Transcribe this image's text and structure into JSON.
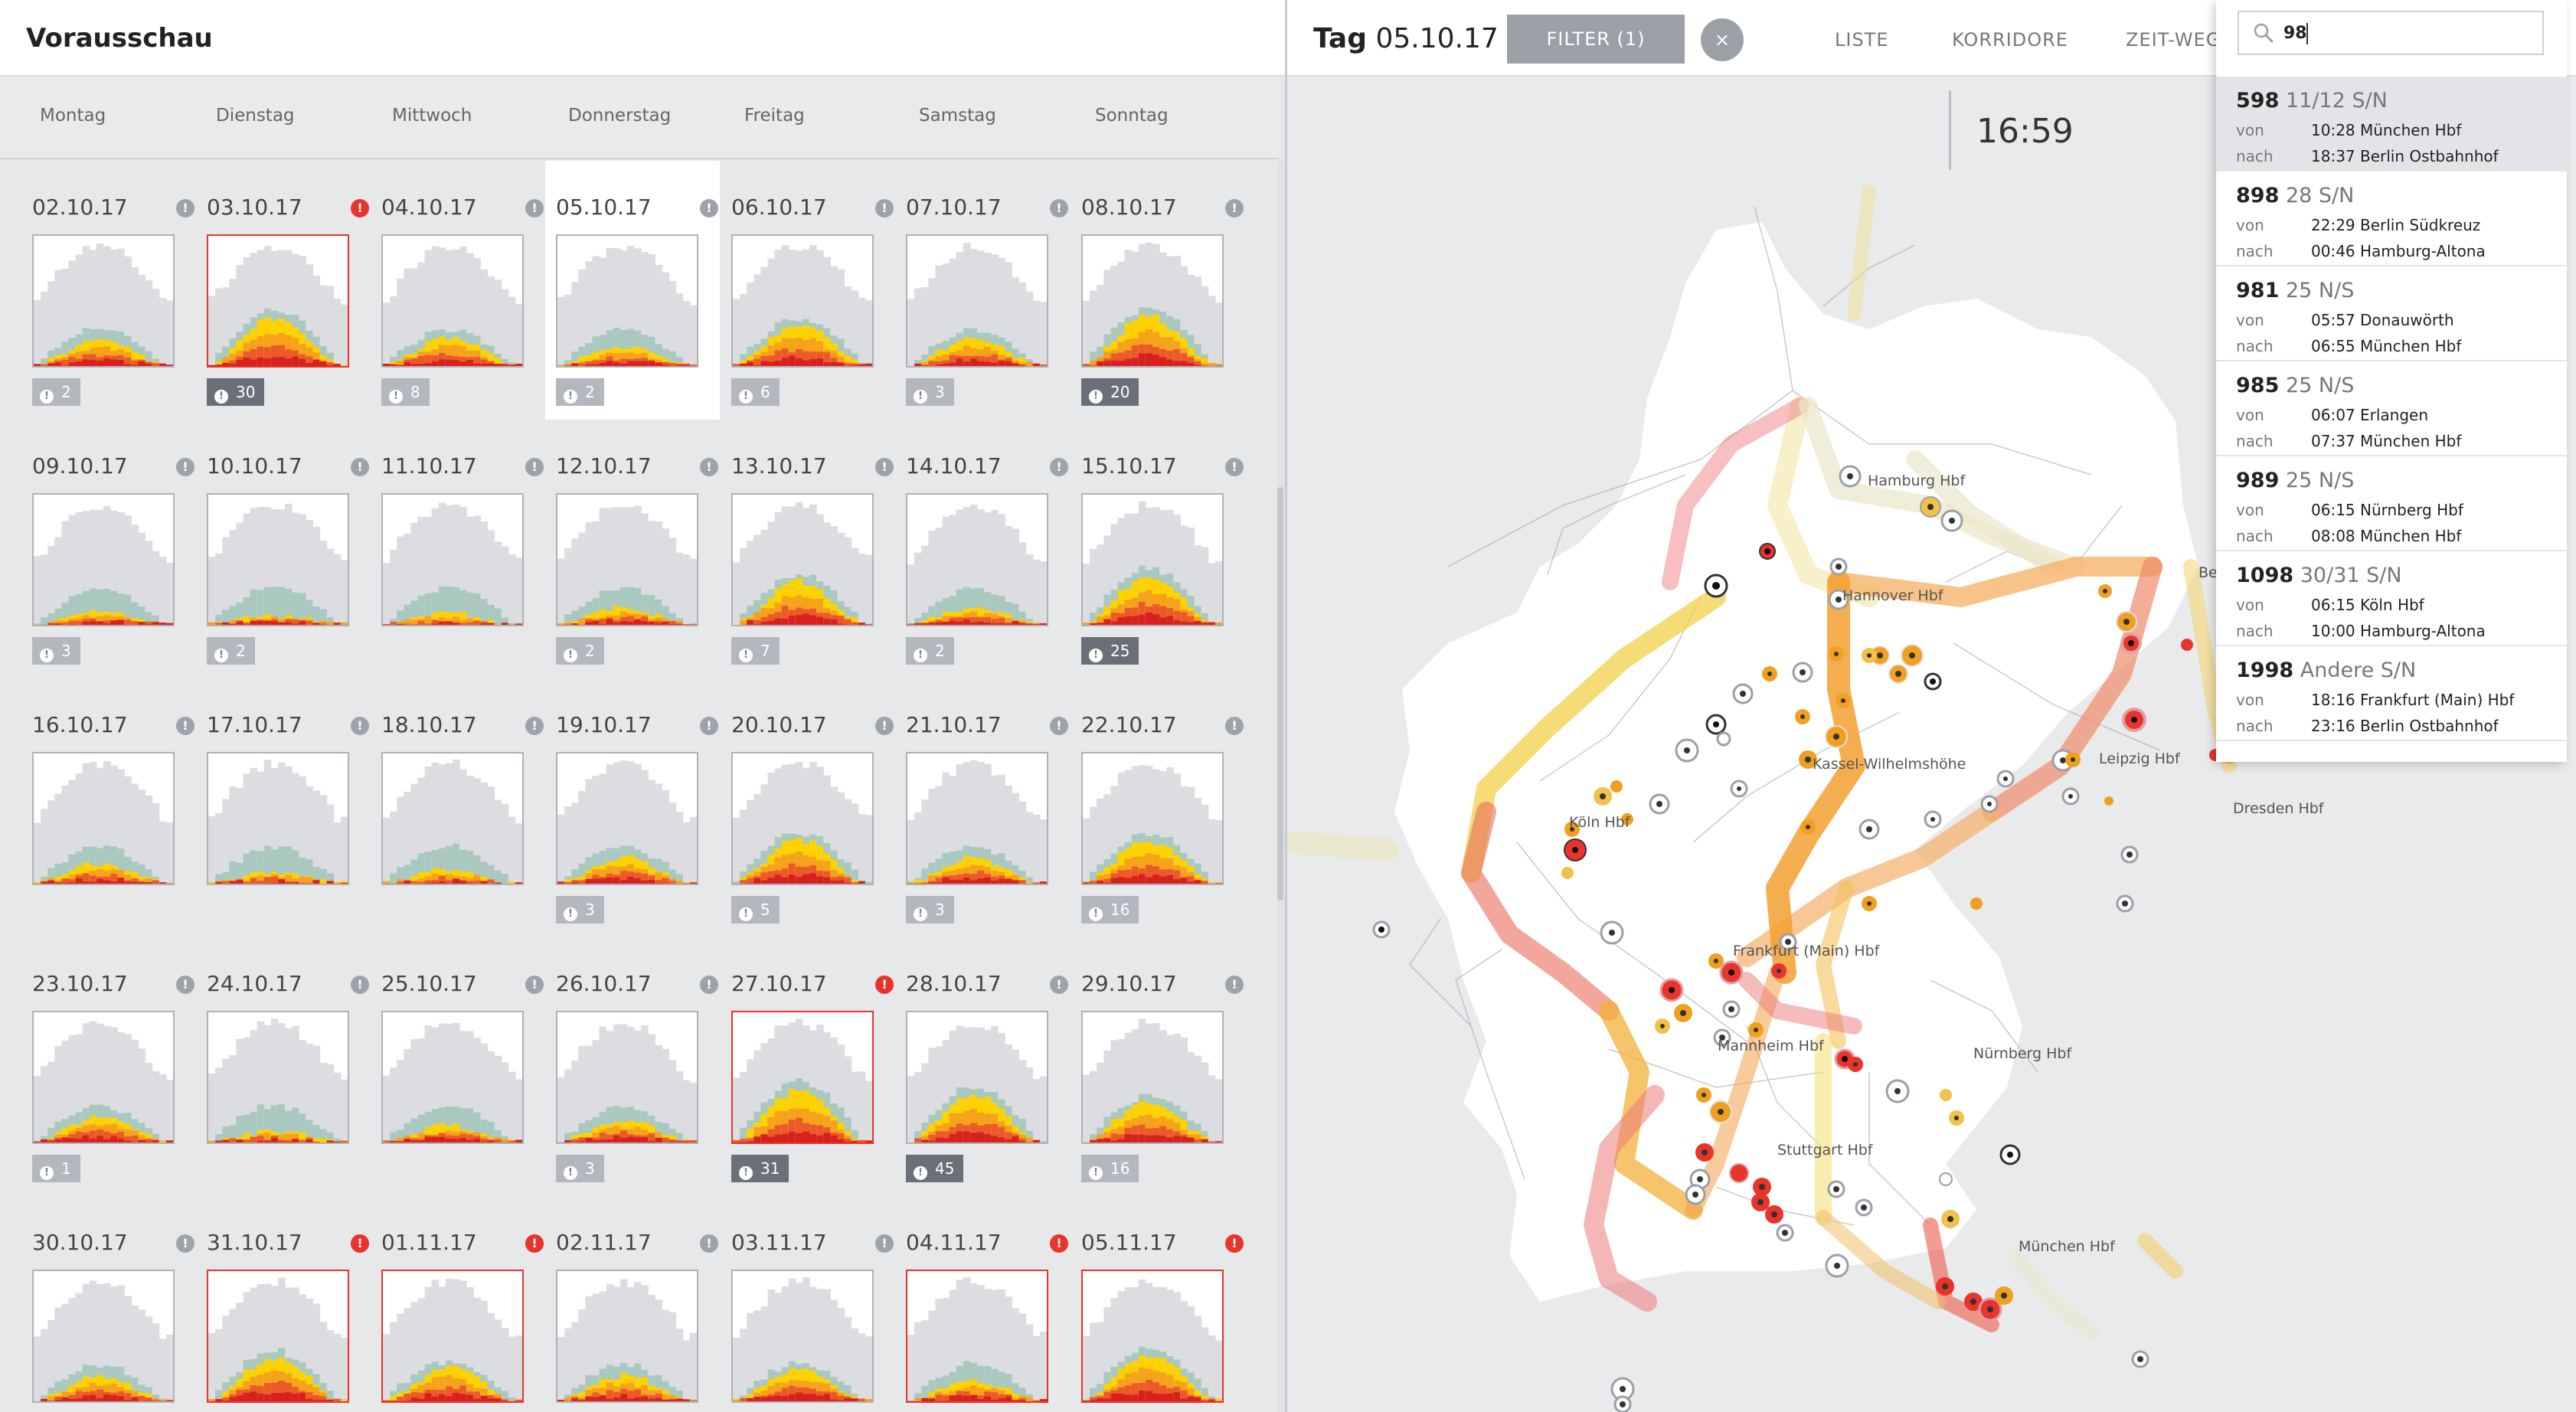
{
  "left": {
    "title": "Vorausschau",
    "weekdays": [
      "Montag",
      "Dienstag",
      "Mittwoch",
      "Donnerstag",
      "Freitag",
      "Samstag",
      "Sonntag"
    ],
    "days": [
      {
        "date": "02.10.17",
        "count": "2",
        "alert": false,
        "dark": false,
        "selected": false,
        "intensity": 0.45
      },
      {
        "date": "03.10.17",
        "count": "30",
        "alert": true,
        "dark": true,
        "selected": false,
        "intensity": 0.85
      },
      {
        "date": "04.10.17",
        "count": "8",
        "alert": false,
        "dark": false,
        "selected": false,
        "intensity": 0.5
      },
      {
        "date": "05.10.17",
        "count": "2",
        "alert": false,
        "dark": false,
        "selected": true,
        "intensity": 0.35
      },
      {
        "date": "06.10.17",
        "count": "6",
        "alert": false,
        "dark": false,
        "selected": false,
        "intensity": 0.7
      },
      {
        "date": "07.10.17",
        "count": "3",
        "alert": false,
        "dark": false,
        "selected": false,
        "intensity": 0.5
      },
      {
        "date": "08.10.17",
        "count": "20",
        "alert": false,
        "dark": true,
        "selected": false,
        "intensity": 0.85
      },
      {
        "date": "09.10.17",
        "count": "3",
        "alert": false,
        "dark": false,
        "selected": false,
        "intensity": 0.25
      },
      {
        "date": "10.10.17",
        "count": "2",
        "alert": false,
        "dark": false,
        "selected": false,
        "intensity": 0.15
      },
      {
        "date": "11.10.17",
        "count": "",
        "alert": false,
        "dark": false,
        "selected": false,
        "intensity": 0.2
      },
      {
        "date": "12.10.17",
        "count": "2",
        "alert": false,
        "dark": false,
        "selected": false,
        "intensity": 0.3
      },
      {
        "date": "13.10.17",
        "count": "7",
        "alert": false,
        "dark": false,
        "selected": false,
        "intensity": 0.75
      },
      {
        "date": "14.10.17",
        "count": "2",
        "alert": false,
        "dark": false,
        "selected": false,
        "intensity": 0.3
      },
      {
        "date": "15.10.17",
        "count": "25",
        "alert": false,
        "dark": true,
        "selected": false,
        "intensity": 0.85
      },
      {
        "date": "16.10.17",
        "count": "",
        "alert": false,
        "dark": false,
        "selected": false,
        "intensity": 0.35
      },
      {
        "date": "17.10.17",
        "count": "",
        "alert": false,
        "dark": false,
        "selected": false,
        "intensity": 0.2
      },
      {
        "date": "18.10.17",
        "count": "",
        "alert": false,
        "dark": false,
        "selected": false,
        "intensity": 0.25
      },
      {
        "date": "19.10.17",
        "count": "3",
        "alert": false,
        "dark": false,
        "selected": false,
        "intensity": 0.45
      },
      {
        "date": "20.10.17",
        "count": "5",
        "alert": false,
        "dark": false,
        "selected": false,
        "intensity": 0.75
      },
      {
        "date": "21.10.17",
        "count": "3",
        "alert": false,
        "dark": false,
        "selected": false,
        "intensity": 0.45
      },
      {
        "date": "22.10.17",
        "count": "16",
        "alert": false,
        "dark": false,
        "selected": false,
        "intensity": 0.75
      },
      {
        "date": "23.10.17",
        "count": "1",
        "alert": false,
        "dark": false,
        "selected": false,
        "intensity": 0.45
      },
      {
        "date": "24.10.17",
        "count": "",
        "alert": false,
        "dark": false,
        "selected": false,
        "intensity": 0.2
      },
      {
        "date": "25.10.17",
        "count": "",
        "alert": false,
        "dark": false,
        "selected": false,
        "intensity": 0.3
      },
      {
        "date": "26.10.17",
        "count": "3",
        "alert": false,
        "dark": false,
        "selected": false,
        "intensity": 0.4
      },
      {
        "date": "27.10.17",
        "count": "31",
        "alert": true,
        "dark": true,
        "selected": false,
        "intensity": 0.9
      },
      {
        "date": "28.10.17",
        "count": "45",
        "alert": false,
        "dark": true,
        "selected": false,
        "intensity": 0.85
      },
      {
        "date": "29.10.17",
        "count": "16",
        "alert": false,
        "dark": false,
        "selected": false,
        "intensity": 0.7
      },
      {
        "date": "30.10.17",
        "count": "",
        "alert": false,
        "dark": false,
        "selected": false,
        "intensity": 0.45
      },
      {
        "date": "31.10.17",
        "count": "",
        "alert": true,
        "dark": false,
        "selected": false,
        "intensity": 0.75
      },
      {
        "date": "01.11.17",
        "count": "",
        "alert": true,
        "dark": false,
        "selected": false,
        "intensity": 0.6
      },
      {
        "date": "02.11.17",
        "count": "",
        "alert": false,
        "dark": false,
        "selected": false,
        "intensity": 0.45
      },
      {
        "date": "03.11.17",
        "count": "",
        "alert": false,
        "dark": false,
        "selected": false,
        "intensity": 0.55
      },
      {
        "date": "04.11.17",
        "count": "",
        "alert": true,
        "dark": false,
        "selected": false,
        "intensity": 0.35
      },
      {
        "date": "05.11.17",
        "count": "",
        "alert": true,
        "dark": false,
        "selected": false,
        "intensity": 0.8
      }
    ]
  },
  "header": {
    "tag_prefix": "Tag",
    "tag_date": "05.10.17",
    "filter_label": "FILTER (1)",
    "close_label": "×",
    "nav": [
      "LISTE",
      "KORRIDORE",
      "ZEIT-WEG"
    ]
  },
  "time": "16:59",
  "search": {
    "value": "98"
  },
  "results": [
    {
      "num": "598",
      "rest": " 11/12 S/N",
      "from_label": "von",
      "to_label": "nach",
      "from": "10:28 München Hbf",
      "to": "18:37 Berlin Ostbahnhof"
    },
    {
      "num": "898",
      "rest": " 28 S/N",
      "from_label": "von",
      "to_label": "nach",
      "from": "22:29 Berlin Südkreuz",
      "to": "00:46 Hamburg-Altona"
    },
    {
      "num": "981",
      "rest": " 25 N/S",
      "from_label": "von",
      "to_label": "nach",
      "from": "05:57 Donauwörth",
      "to": "06:55 München Hbf"
    },
    {
      "num": "985",
      "rest": " 25 N/S",
      "from_label": "von",
      "to_label": "nach",
      "from": "06:07 Erlangen",
      "to": "07:37 München Hbf"
    },
    {
      "num": "989",
      "rest": " 25 N/S",
      "from_label": "von",
      "to_label": "nach",
      "from": "06:15 Nürnberg Hbf",
      "to": "08:08 München Hbf"
    },
    {
      "num": "1098",
      "rest": " 30/31 S/N",
      "from_label": "von",
      "to_label": "nach",
      "from": "06:15 Köln Hbf",
      "to": "10:00 Hamburg-Altona"
    },
    {
      "num": "1998",
      "rest": " Andere S/N",
      "from_label": "von",
      "to_label": "nach",
      "from": "18:16 Frankfurt (Main) Hbf",
      "to": "23:16 Berlin Ostbahnhof"
    }
  ],
  "map": {
    "stations": [
      "Hamburg Hbf",
      "Hannover Hbf",
      "Berlin Hbf",
      "Kassel-Wilhelmshöhe",
      "Leipzig Hbf",
      "Dresden Hbf",
      "Köln Hbf",
      "Frankfurt (Main) Hbf",
      "Mannheim Hbf",
      "Nürnberg Hbf",
      "Stuttgart Hbf",
      "München Hbf"
    ]
  },
  "colors": {
    "accent": "#e8342b",
    "badge": "#b4b8be",
    "badge_dark": "#6b7078",
    "chart_gray": "#dcdde0",
    "chart_teal": "#a9c9c0",
    "chart_yellow": "#ffd200",
    "chart_orange": "#f7a21b",
    "chart_red": "#ec5a2a",
    "chart_dark_red": "#d8201f"
  }
}
